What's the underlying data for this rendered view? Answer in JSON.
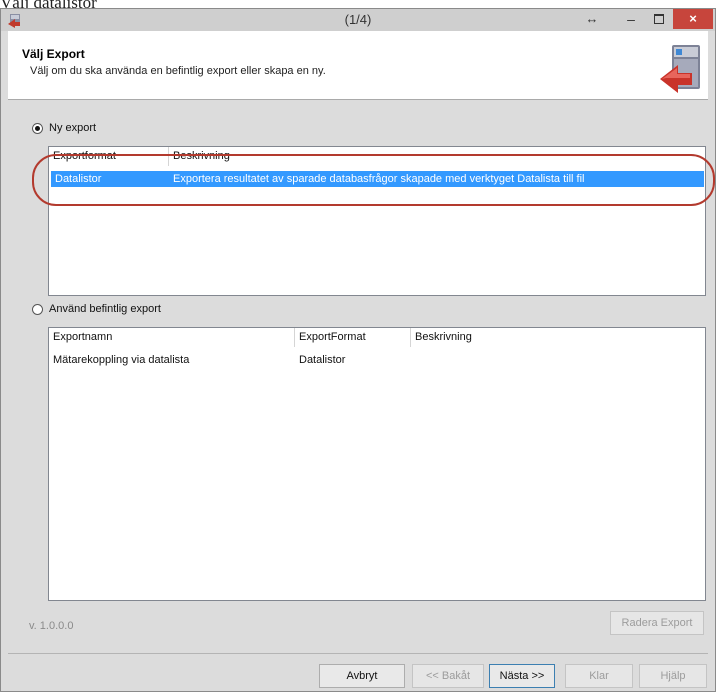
{
  "caption": "Välj datalistor",
  "window": {
    "title": "(1/4)",
    "controls": {
      "resize": "↔",
      "minimize": "–",
      "close": "×"
    }
  },
  "header": {
    "title": "Välj Export",
    "subtitle": "Välj om du ska använda en befintlig export eller skapa en ny."
  },
  "new_export": {
    "label": "Ny export",
    "checked": true,
    "columns": [
      "Exportformat",
      "Beskrivning"
    ],
    "rows": [
      {
        "format": "Datalistor",
        "description": "Exportera resultatet av sparade databasfrågor skapade med verktyget Datalista till fil",
        "selected": true
      }
    ]
  },
  "existing_export": {
    "label": "Använd befintlig export",
    "checked": false,
    "columns": [
      "Exportnamn",
      "ExportFormat",
      "Beskrivning"
    ],
    "rows": [
      {
        "name": "Mätarekoppling via datalista",
        "format": "Datalistor",
        "description": ""
      }
    ]
  },
  "version": "v. 1.0.0.0",
  "buttons": {
    "delete_export": "Radera Export",
    "cancel": "Avbryt",
    "back": "<< Bakåt",
    "next": "Nästa >>",
    "finish": "Klar",
    "help": "Hjälp"
  },
  "colors": {
    "selection": "#3399ff",
    "close_button": "#c7453c",
    "highlight_ring": "#b33a2e"
  }
}
